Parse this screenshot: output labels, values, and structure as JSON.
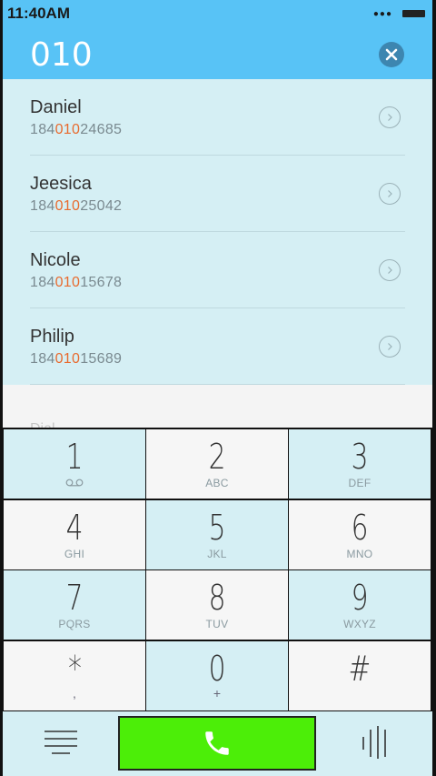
{
  "status_bar": {
    "time": "11:40AM"
  },
  "header": {
    "dialed": "010"
  },
  "contacts": [
    {
      "name": "Daniel",
      "number_prefix": "184",
      "number_match": "010",
      "number_suffix": "24685"
    },
    {
      "name": "Jeesica",
      "number_prefix": "184",
      "number_match": "010",
      "number_suffix": "25042"
    },
    {
      "name": "Nicole",
      "number_prefix": "184",
      "number_match": "010",
      "number_suffix": "15678"
    },
    {
      "name": "Philip",
      "number_prefix": "184",
      "number_match": "010",
      "number_suffix": "15689"
    }
  ],
  "lower_label": "Dial",
  "keypad": {
    "keys": [
      {
        "digit": "1",
        "sub": "voicemail-icon"
      },
      {
        "digit": "2",
        "sub": "ABC"
      },
      {
        "digit": "3",
        "sub": "DEF"
      },
      {
        "digit": "4",
        "sub": "GHI"
      },
      {
        "digit": "5",
        "sub": "JKL"
      },
      {
        "digit": "6",
        "sub": "MNO"
      },
      {
        "digit": "7",
        "sub": "PQRS"
      },
      {
        "digit": "8",
        "sub": "TUV"
      },
      {
        "digit": "9",
        "sub": "WXYZ"
      },
      {
        "digit": "*",
        "sub": ","
      },
      {
        "digit": "0",
        "sub": "+"
      },
      {
        "digit": "#",
        "sub": ""
      }
    ]
  },
  "colors": {
    "header_bg": "#58c3f6",
    "list_bg": "#d5eff4",
    "match_highlight": "#e86a2e",
    "call_button": "#4cee08"
  },
  "icons": {
    "clear": "close-circle-icon",
    "row_action": "chevron-right-icon",
    "menu": "menu-lines-icon",
    "call": "phone-icon",
    "dialpad_toggle": "vertical-lines-icon"
  }
}
